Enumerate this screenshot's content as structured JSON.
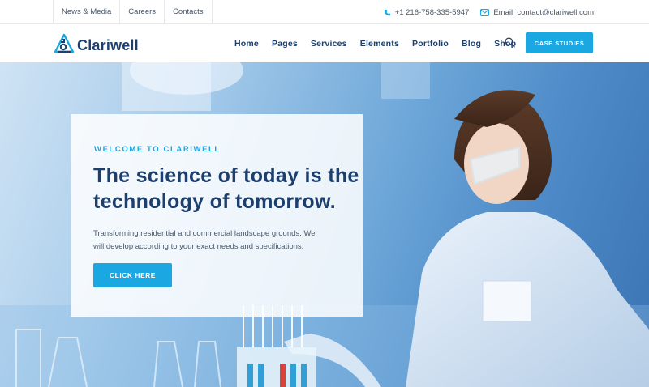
{
  "topbar": {
    "links": [
      "News & Media",
      "Careers",
      "Contacts"
    ],
    "phone": "+1 216-758-335-5947",
    "email": "Email: contact@clariwell.com"
  },
  "header": {
    "brand": "Clariwell",
    "nav": [
      "Home",
      "Pages",
      "Services",
      "Elements",
      "Portfolio",
      "Blog",
      "Shop"
    ],
    "cta_label": "CASE STUDIES"
  },
  "hero": {
    "eyebrow": "WELCOME TO CLARIWELL",
    "title_line1": "The science of today is the",
    "title_line2": "technology of tomorrow.",
    "description_line1": "Transforming residential and commercial landscape grounds. We",
    "description_line2": "will develop according to your exact needs and specifications.",
    "button_label": "CLICK HERE"
  },
  "colors": {
    "accent": "#1aa7e2",
    "navy": "#1d3f6e",
    "text_muted": "#4a5868"
  },
  "icons": [
    "phone-icon",
    "email-icon",
    "search-icon",
    "logo-flask-icon"
  ]
}
